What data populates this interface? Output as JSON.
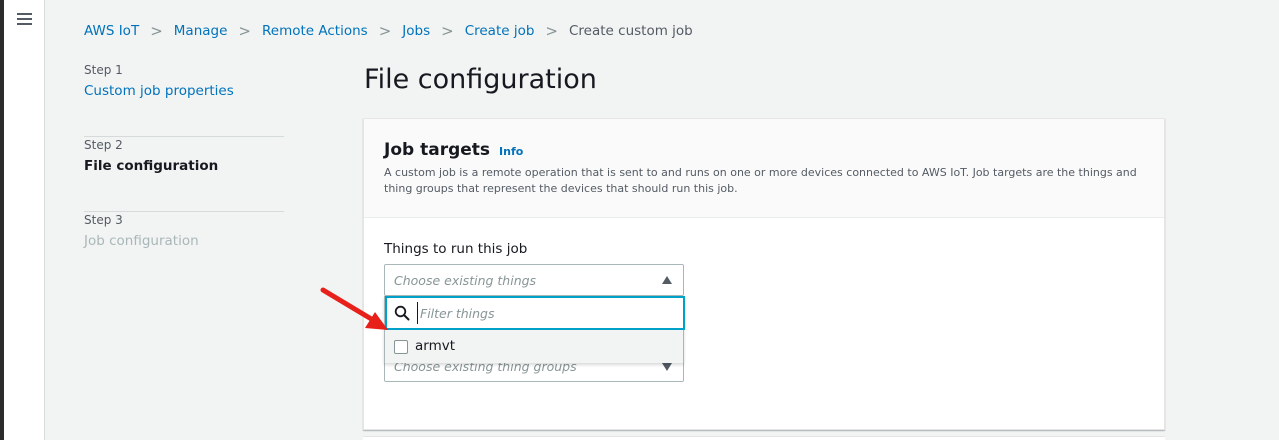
{
  "nav": {
    "menu_icon": "hamburger-menu-icon"
  },
  "breadcrumb": {
    "items": [
      "AWS IoT",
      "Manage",
      "Remote Actions",
      "Jobs",
      "Create job"
    ],
    "current": "Create custom job",
    "separator": ">"
  },
  "steps": [
    {
      "label": "Step 1",
      "title": "Custom job properties"
    },
    {
      "label": "Step 2",
      "title": "File configuration"
    },
    {
      "label": "Step 3",
      "title": "Job configuration"
    }
  ],
  "page": {
    "title": "File configuration"
  },
  "job_targets": {
    "title": "Job targets",
    "info": "Info",
    "description": "A custom job is a remote operation that is sent to and runs on one or more devices connected to AWS IoT. Job targets are the things and thing groups that represent the devices that should run this job.",
    "things_label": "Things to run this job",
    "things_placeholder": "Choose existing things",
    "filter_placeholder": "Filter things",
    "options": [
      "armvt"
    ],
    "groups_placeholder": "Choose existing thing groups"
  },
  "colors": {
    "link": "#0073bb",
    "focus": "#00a1c9",
    "annotation_arrow": "#e8201a"
  }
}
